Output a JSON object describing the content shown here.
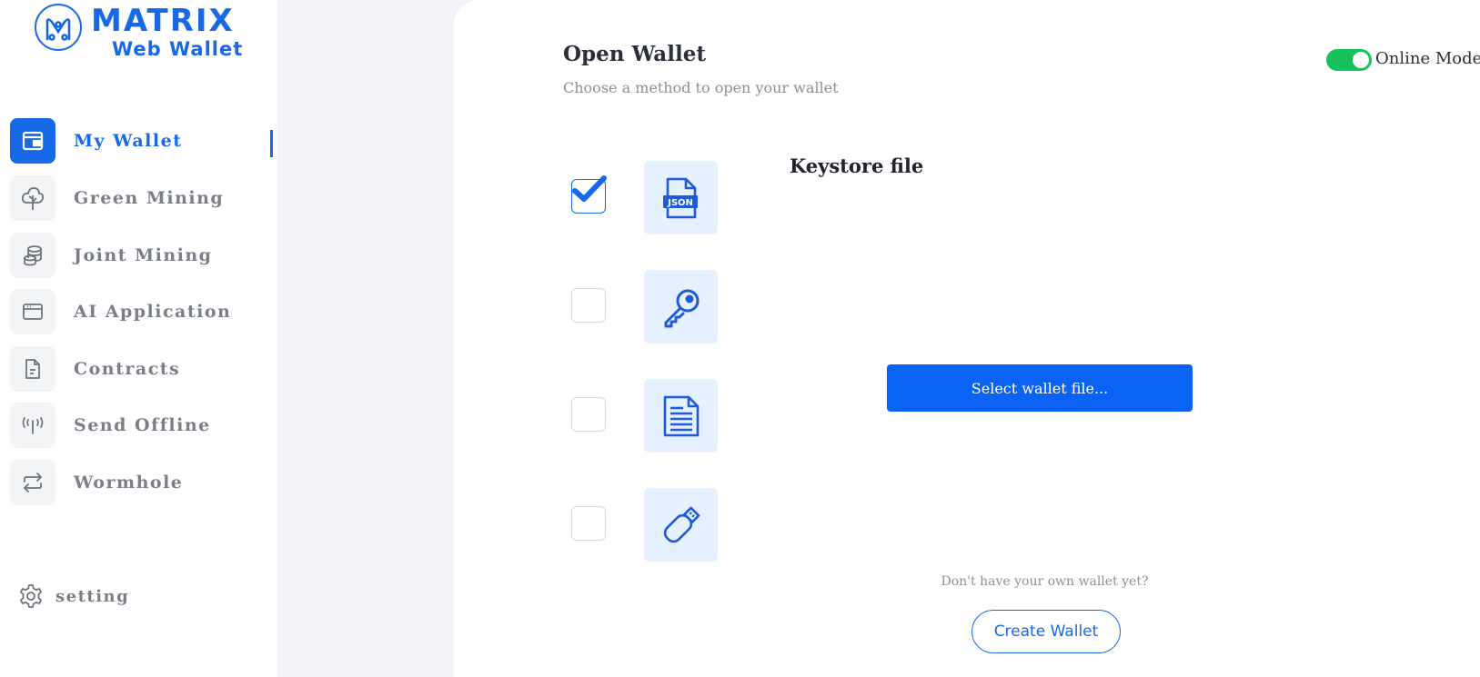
{
  "logo": {
    "title": "MATRIX",
    "subtitle": "Web Wallet"
  },
  "sidebar": {
    "items": [
      {
        "label": "My Wallet",
        "icon": "wallet-icon",
        "active": true
      },
      {
        "label": "Green Mining",
        "icon": "tree-icon",
        "active": false
      },
      {
        "label": "Joint Mining",
        "icon": "coins-stack-icon",
        "active": false
      },
      {
        "label": "AI Application",
        "icon": "browser-window-icon",
        "active": false
      },
      {
        "label": "Contracts",
        "icon": "document-icon",
        "active": false
      },
      {
        "label": "Send Offline",
        "icon": "antenna-icon",
        "active": false
      },
      {
        "label": "Wormhole",
        "icon": "swap-arrows-icon",
        "active": false
      }
    ],
    "setting_label": "setting"
  },
  "main": {
    "title": "Open Wallet",
    "subtitle": "Choose a method to open your wallet",
    "online_toggle": {
      "label": "Online Mode",
      "on": true
    },
    "methods": [
      {
        "icon": "json-file-icon",
        "checked": true
      },
      {
        "icon": "key-icon",
        "checked": false
      },
      {
        "icon": "mnemonic-document-icon",
        "checked": false
      },
      {
        "icon": "usb-drive-icon",
        "checked": false
      }
    ],
    "method_heading": "Keystore file",
    "select_button": "Select wallet file...",
    "no_wallet_text": "Don't have your own wallet yet?",
    "create_button": "Create Wallet"
  },
  "colors": {
    "accent": "#1769e8",
    "button_blue": "#0b63f6",
    "toggle_green": "#19c15b",
    "tile_bg": "#e5f1fe",
    "muted_text": "#7a7f88"
  }
}
